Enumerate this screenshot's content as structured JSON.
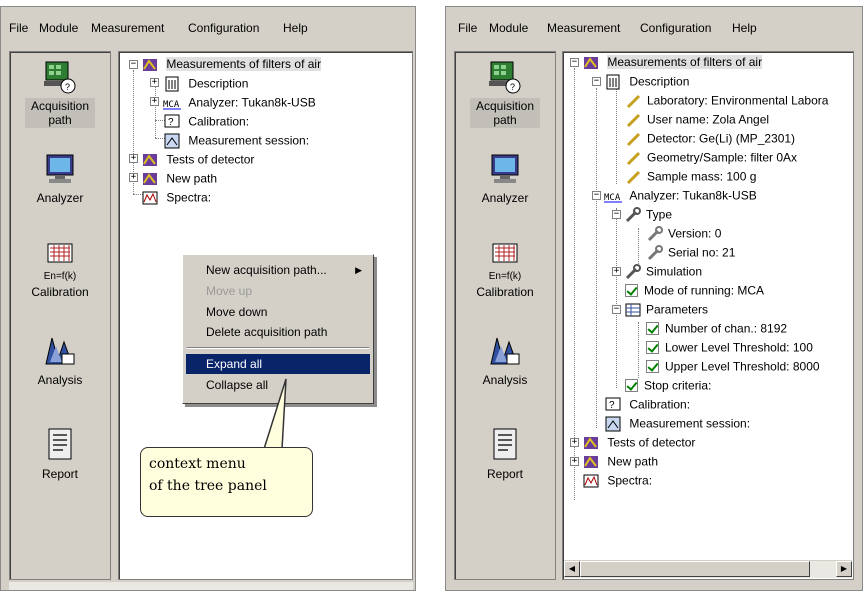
{
  "menu": [
    "File",
    "Module",
    "Measurement",
    "Configuration",
    "Help"
  ],
  "toolbar": [
    {
      "label": "Acquisition path",
      "icon": "acquisition-path-icon",
      "selected": true
    },
    {
      "label": "Analyzer",
      "icon": "analyzer-icon"
    },
    {
      "label": "En=f(k)",
      "sublabel": "Calibration",
      "icon": "calibration-icon"
    },
    {
      "label": "Analysis",
      "icon": "analysis-icon"
    },
    {
      "label": "Report",
      "icon": "report-icon"
    }
  ],
  "left_tree": [
    "Measurements of filters of air",
    "Description",
    "Analyzer: Tukan8k-USB",
    "Calibration:",
    "Measurement session:",
    "Tests of detector",
    "New path",
    "Spectra:"
  ],
  "context_menu": {
    "items": [
      "New acquisition path...",
      "Move up",
      "Move down",
      "Delete acquisition path",
      "Expand all",
      "Collapse all"
    ],
    "highlighted": "Expand all",
    "disabled": [
      "Move up"
    ]
  },
  "callout": [
    "context menu",
    "of the tree panel"
  ],
  "right_tree": [
    "Measurements of filters of air",
    "Description",
    "Laboratory: Environmental Labora",
    "User name: Zola Angel",
    "Detector: Ge(Li) (MP_2301)",
    "Geometry/Sample: filter 0Ax",
    "Sample mass: 100 g",
    "Analyzer: Tukan8k-USB",
    "Type",
    "Version: 0",
    "Serial no: 21",
    "Simulation",
    "Mode of running: MCA",
    "Parameters",
    "Number of chan.: 8192",
    "Lower Level Threshold: 100",
    "Upper Level Threshold: 8000",
    "Stop criteria:",
    "Calibration:",
    "Measurement session:",
    "Tests of detector",
    "New path",
    "Spectra:"
  ],
  "colors": {
    "highlight": "#0a246a",
    "window": "#d4d0c8",
    "callout": "#ffffde"
  }
}
